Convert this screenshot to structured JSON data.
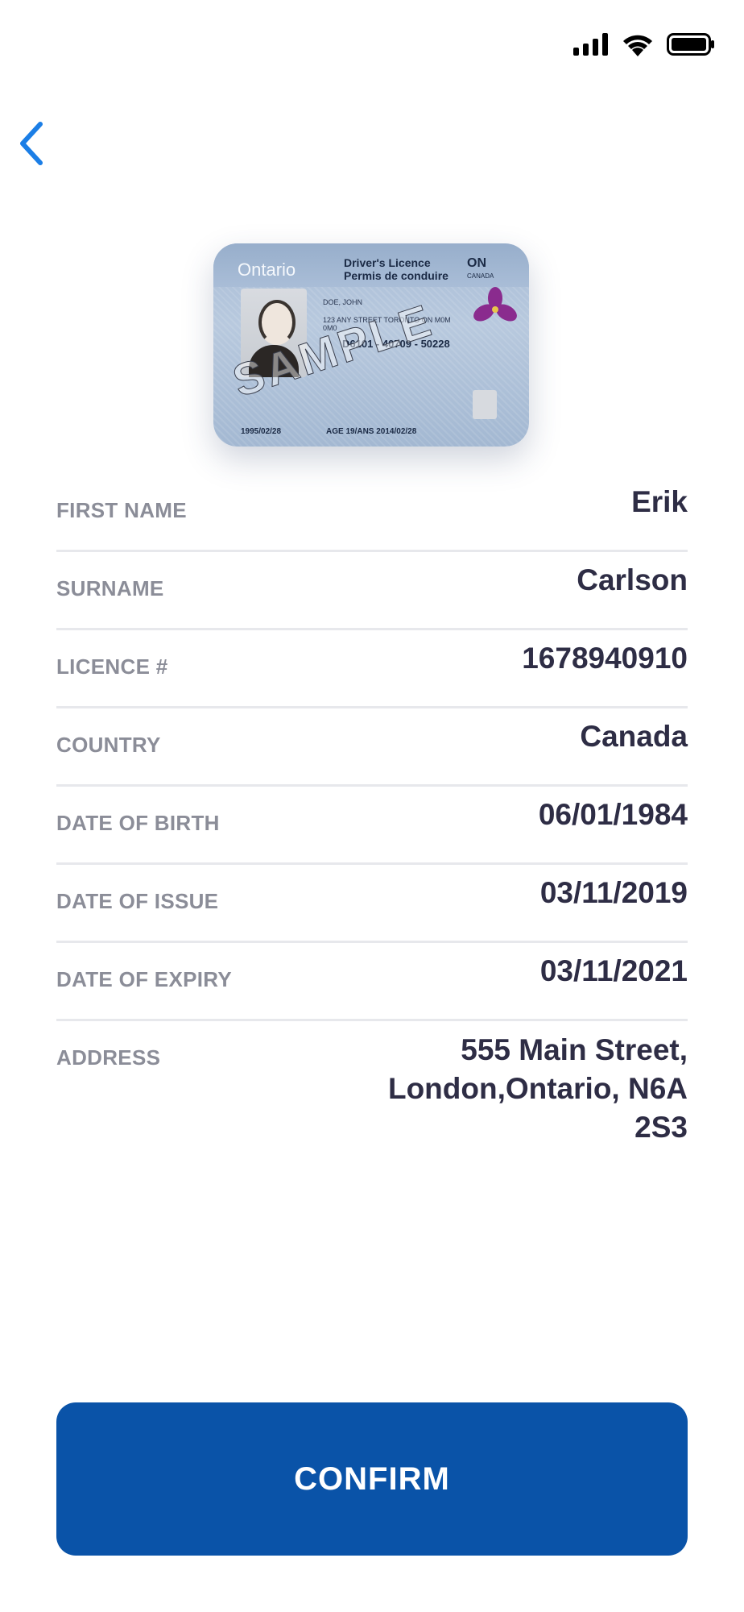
{
  "status_bar": {
    "icons": [
      "signal-icon",
      "wifi-icon",
      "battery-icon"
    ]
  },
  "nav": {
    "back_icon": "chevron-left-icon",
    "accent_color": "#1b7ee6"
  },
  "licence_card": {
    "province": "Ontario",
    "title_en": "Driver's Licence",
    "title_fr": "Permis de conduire",
    "code": "ON",
    "country_code": "CANADA",
    "holder_name": "DOE, JOHN",
    "holder_address": "123 ANY STREET TORONTO ON M0M 0M0",
    "licence_number": "D6101 - 40709 - 50228",
    "watermark": "SAMPLE",
    "dob_line": "1995/02/28",
    "age_line": "AGE 19/ANS 2014/02/28"
  },
  "details": [
    {
      "label": "FIRST NAME",
      "value": "Erik"
    },
    {
      "label": "SURNAME",
      "value": "Carlson"
    },
    {
      "label": "LICENCE #",
      "value": "1678940910"
    },
    {
      "label": "COUNTRY",
      "value": "Canada"
    },
    {
      "label": "DATE OF BIRTH",
      "value": "06/01/1984"
    },
    {
      "label": "DATE OF ISSUE",
      "value": "03/11/2019"
    },
    {
      "label": "DATE OF EXPIRY",
      "value": "03/11/2021"
    },
    {
      "label": "ADDRESS",
      "value": "555 Main Street, London,Ontario, N6A 2S3"
    }
  ],
  "confirm": {
    "label": "CONFIRM",
    "color": "#0a53a8"
  }
}
